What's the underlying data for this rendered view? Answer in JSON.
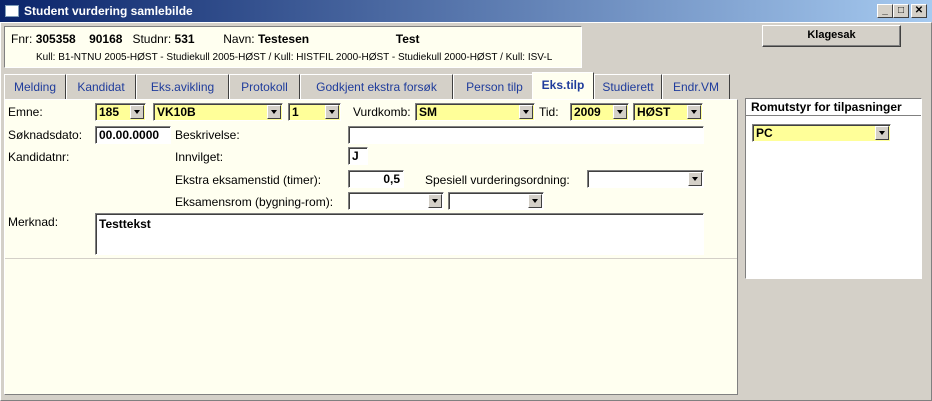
{
  "window": {
    "title": "Student vurdering samlebilde"
  },
  "info": {
    "fnr_label": "Fnr:",
    "fnr_value": "305358",
    "fnr_value2": "90168",
    "studnr_label": "Studnr:",
    "studnr_value": "531",
    "navn_label": "Navn:",
    "navn_last": "Testesen",
    "navn_first": "Test",
    "kull_text": "Kull: B1-NTNU 2005-HØST - Studiekull 2005-HØST / Kull: HISTFIL 2000-HØST - Studiekull 2000-HØST / Kull: ISV-L"
  },
  "klagesak_button": "Klagesak",
  "tabs": [
    "Melding",
    "Kandidat",
    "Eks.avikling",
    "Protokoll",
    "Godkjent ekstra forsøk",
    "Person tilp",
    "Eks.tilp",
    "Studierett",
    "Endr.VM"
  ],
  "active_tab": "Eks.tilp",
  "form": {
    "emne_label": "Emne:",
    "emne_code": "185",
    "emne_name": "VK10B",
    "emne_version": "1",
    "vurdkomb_label": "Vurdkomb:",
    "vurdkomb_value": "SM",
    "tid_label": "Tid:",
    "tid_year": "2009",
    "tid_term": "HØST",
    "soknadsdato_label": "Søknadsdato:",
    "soknadsdato_value": "00.00.0000",
    "beskrivelse_label": "Beskrivelse:",
    "beskrivelse_value": "",
    "kandidatnr_label": "Kandidatnr:",
    "kandidatnr_value": "",
    "innvilget_label": "Innvilget:",
    "innvilget_value": "J",
    "ekstra_tid_label": "Ekstra eksamenstid (timer):",
    "ekstra_tid_value": "0,5",
    "spesiell_label": "Spesiell vurderingsordning:",
    "spesiell_value": "",
    "eksamensrom_label": "Eksamensrom (bygning-rom):",
    "eksamensrom_bygning": "",
    "eksamensrom_rom": "",
    "merknad_label": "Merknad:",
    "merknad_value": "Testtekst"
  },
  "romutstyr": {
    "header": "Romutstyr for tilpasninger",
    "value": "PC"
  }
}
